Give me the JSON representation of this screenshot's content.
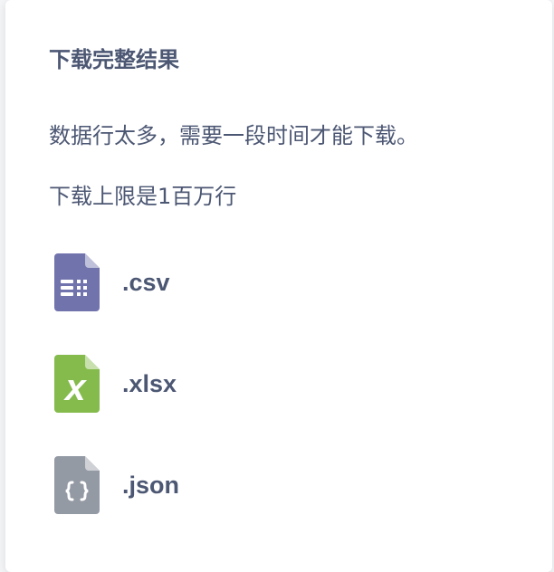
{
  "dialog": {
    "title": "下载完整结果",
    "description": "数据行太多，需要一段时间才能下载。",
    "limit_note": "下载上限是1百万行"
  },
  "formats": [
    {
      "label": ".csv",
      "icon": "csv-file-icon",
      "color": "#7173ad"
    },
    {
      "label": ".xlsx",
      "icon": "xlsx-file-icon",
      "color": "#84bb4c"
    },
    {
      "label": ".json",
      "icon": "json-file-icon",
      "color": "#949aa4"
    }
  ],
  "colors": {
    "text": "#4c5773",
    "panel_bg": "#ffffff"
  }
}
